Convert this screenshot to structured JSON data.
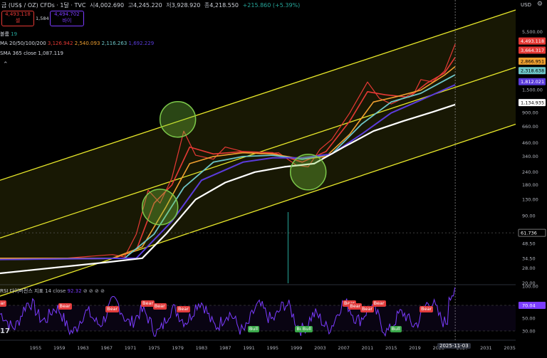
{
  "header": {
    "title": "금 (US$ / OZ) CFDs · 1달 · TVC",
    "open_label": "시",
    "open": "4,002.690",
    "high_label": "고",
    "high": "4,245.220",
    "low_label": "저",
    "low": "3,928.920",
    "close_label": "종",
    "close": "4,218.550",
    "change": "+215.860 (+5.39%)",
    "sell_price": "4,493.118",
    "sell_label": "셀",
    "spread": "1,584",
    "buy_price": "4,494.702",
    "buy_label": "바이",
    "volume_label": "볼륨",
    "volume_value": "19",
    "ma_label": "MA 20/50/100/200",
    "ma_values": [
      "3,126.942",
      "2,540.093",
      "2,116.263",
      "1,692.229"
    ],
    "sma_label": "SMA 365 close",
    "sma_value": "1,087.119",
    "currency": "USD"
  },
  "colors": {
    "ma20": "#e53935",
    "ma50": "#f0a030",
    "ma100": "#6ec6c8",
    "ma200": "#5b3cdc",
    "sma365": "#ffffff",
    "channel": "#e8e82a",
    "candle": "#e53935",
    "rsi": "#7b3cff"
  },
  "price_tags": [
    {
      "value": "4,493.118",
      "bg": "#e53935"
    },
    {
      "value": "3,664.317",
      "bg": "#e53935"
    },
    {
      "value": "2,866.951",
      "bg": "#f0a030"
    },
    {
      "value": "2,318.638",
      "bg": "#6ec6c8"
    },
    {
      "value": "1,812.021",
      "bg": "#5b3cdc"
    },
    {
      "value": "1,134.935",
      "bg": "#ffffff"
    },
    {
      "value": "61.736",
      "bg": "#000000"
    }
  ],
  "rsi": {
    "label": "RSI 다이버전스 지표",
    "params": "14 close",
    "value": "92.32",
    "current": "70.04",
    "signals": [
      {
        "year": 1949,
        "type": "bear"
      },
      {
        "year": 1960,
        "type": "bear"
      },
      {
        "year": 1968,
        "type": "bear"
      },
      {
        "year": 1974,
        "type": "bear"
      },
      {
        "year": 1976,
        "type": "bear"
      },
      {
        "year": 1980,
        "type": "bear"
      },
      {
        "year": 1992,
        "type": "bull"
      },
      {
        "year": 2000,
        "type": "bull"
      },
      {
        "year": 2001,
        "type": "bull"
      },
      {
        "year": 2008,
        "type": "bear"
      },
      {
        "year": 2009,
        "type": "bear"
      },
      {
        "year": 2011,
        "type": "bear"
      },
      {
        "year": 2013,
        "type": "bear"
      },
      {
        "year": 2016,
        "type": "bull"
      },
      {
        "year": 2021,
        "type": "bear"
      }
    ]
  },
  "chart_data": {
    "type": "line",
    "title": "금 (US$ / OZ) CFDs · 1달 · TVC",
    "ylabel": "USD",
    "log_scale": true,
    "xlim": [
      1949,
      2036
    ],
    "ylim": [
      20,
      9000
    ],
    "x_ticks": [
      "1955",
      "1959",
      "1963",
      "1967",
      "1971",
      "1975",
      "1979",
      "1983",
      "1987",
      "1991",
      "1995",
      "1999",
      "2003",
      "2007",
      "2011",
      "2015",
      "2019",
      "2023",
      "2027",
      "2031",
      "2035"
    ],
    "y_ticks": [
      "5,500.00",
      "3,500.00",
      "1,500.00",
      "900.00",
      "660.00",
      "460.00",
      "340.00",
      "240.00",
      "180.00",
      "130.00",
      "90.00",
      "48.50",
      "34.50",
      "28.00",
      "20.00"
    ],
    "cursor_x_label": "2025-11-03",
    "series": [
      {
        "name": "gold price",
        "x": [
          1949,
          1960,
          1968,
          1970,
          1972,
          1974,
          1976,
          1978,
          1980,
          1982,
          1985,
          1987,
          1990,
          1993,
          1996,
          1999,
          2001,
          2003,
          2005,
          2008,
          2011,
          2013,
          2015,
          2017,
          2019,
          2020,
          2022,
          2024,
          2025.8
        ],
        "y": [
          35,
          35,
          38,
          36,
          60,
          160,
          120,
          210,
          600,
          350,
          320,
          420,
          380,
          360,
          370,
          280,
          270,
          400,
          500,
          900,
          1800,
          1250,
          1100,
          1250,
          1450,
          1900,
          1800,
          2300,
          4200
        ]
      },
      {
        "name": "MA 20",
        "x": [
          1949,
          1968,
          1972,
          1975,
          1978,
          1981,
          1985,
          1990,
          1995,
          2000,
          2004,
          2008,
          2011,
          2014,
          2018,
          2021,
          2024,
          2025.8
        ],
        "y": [
          35,
          35,
          42,
          120,
          180,
          420,
          360,
          380,
          370,
          300,
          380,
          750,
          1450,
          1350,
          1280,
          1750,
          2200,
          3126
        ]
      },
      {
        "name": "MA 50",
        "x": [
          1949,
          1968,
          1973,
          1977,
          1981,
          1985,
          1990,
          1995,
          2000,
          2004,
          2008,
          2012,
          2016,
          2020,
          2024,
          2025.8
        ],
        "y": [
          35,
          35,
          45,
          110,
          290,
          340,
          370,
          360,
          320,
          340,
          560,
          1150,
          1300,
          1500,
          2100,
          2540
        ]
      },
      {
        "name": "MA 100",
        "x": [
          1949,
          1970,
          1975,
          1980,
          1985,
          1990,
          1995,
          2000,
          2005,
          2010,
          2015,
          2020,
          2025.8
        ],
        "y": [
          34,
          35,
          60,
          170,
          300,
          340,
          350,
          320,
          360,
          700,
          1150,
          1400,
          2116
        ]
      },
      {
        "name": "MA 200",
        "x": [
          1949,
          1972,
          1978,
          1983,
          1990,
          1995,
          2000,
          2005,
          2010,
          2015,
          2020,
          2025.8
        ],
        "y": [
          34,
          35,
          80,
          200,
          300,
          330,
          330,
          360,
          560,
          900,
          1200,
          1692
        ]
      },
      {
        "name": "SMA 365",
        "x": [
          1949,
          1967,
          1973,
          1977,
          1982,
          1987,
          1992,
          1997,
          2002,
          2007,
          2012,
          2017,
          2022,
          2025.8
        ],
        "y": [
          25,
          32,
          35,
          60,
          130,
          190,
          240,
          270,
          290,
          420,
          600,
          750,
          920,
          1087
        ]
      }
    ],
    "channel_lines": [
      {
        "x": [
          1949,
          2036
        ],
        "y": [
          200,
          9000
        ]
      },
      {
        "x": [
          1949,
          2036
        ],
        "y": [
          55,
          2500
        ]
      },
      {
        "x": [
          1949,
          2036
        ],
        "y": [
          15,
          700
        ]
      }
    ],
    "highlight_circles": [
      {
        "year": 1979,
        "value": 780
      },
      {
        "year": 1976,
        "value": 110
      },
      {
        "year": 2001,
        "value": 240
      }
    ],
    "rsi_series": {
      "name": "RSI 14",
      "y_ticks": [
        "100.00",
        "70.04",
        "50.00",
        "30.00"
      ],
      "ylim": [
        20,
        100
      ]
    }
  }
}
